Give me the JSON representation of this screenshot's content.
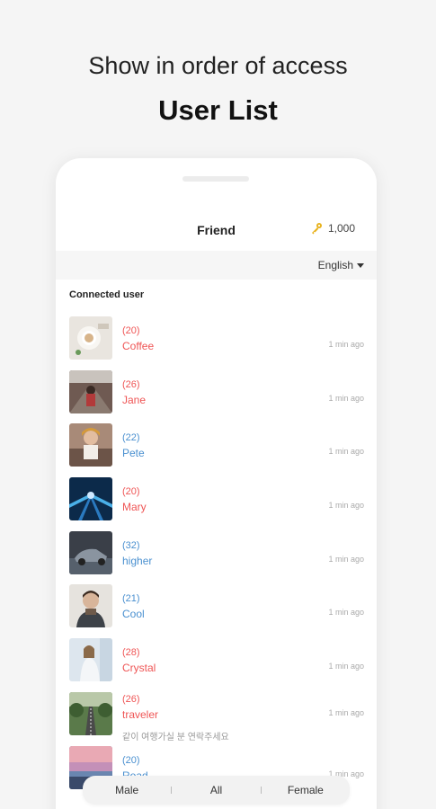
{
  "promo": {
    "subtitle": "Show in order of access",
    "title": "User List"
  },
  "appbar": {
    "title": "Friend",
    "coins": "1,000",
    "coin_icon": "key-icon"
  },
  "language": {
    "selected": "English"
  },
  "section_title": "Connected user",
  "users": [
    {
      "age": "(20)",
      "name": "Coffee",
      "time": "1 min ago",
      "gender": "female",
      "message": ""
    },
    {
      "age": "(26)",
      "name": "Jane",
      "time": "1 min ago",
      "gender": "female",
      "message": ""
    },
    {
      "age": "(22)",
      "name": "Pete",
      "time": "1 min ago",
      "gender": "male",
      "message": ""
    },
    {
      "age": "(20)",
      "name": "Mary",
      "time": "1 min ago",
      "gender": "female",
      "message": ""
    },
    {
      "age": "(32)",
      "name": "higher",
      "time": "1 min ago",
      "gender": "male",
      "message": ""
    },
    {
      "age": "(21)",
      "name": "Cool",
      "time": "1 min ago",
      "gender": "male",
      "message": ""
    },
    {
      "age": "(28)",
      "name": "Crystal",
      "time": "1 min ago",
      "gender": "female",
      "message": ""
    },
    {
      "age": "(26)",
      "name": "traveler",
      "time": "1 min ago",
      "gender": "female",
      "message": "같이 여행가실 분 연락주세요"
    },
    {
      "age": "(20)",
      "name": "Road",
      "time": "1 min ago",
      "gender": "male",
      "message": ""
    }
  ],
  "gender_filter": {
    "male": "Male",
    "all": "All",
    "female": "Female"
  },
  "colors": {
    "female": "#ef5555",
    "male": "#4a90d0",
    "key": "#e8b21c"
  }
}
